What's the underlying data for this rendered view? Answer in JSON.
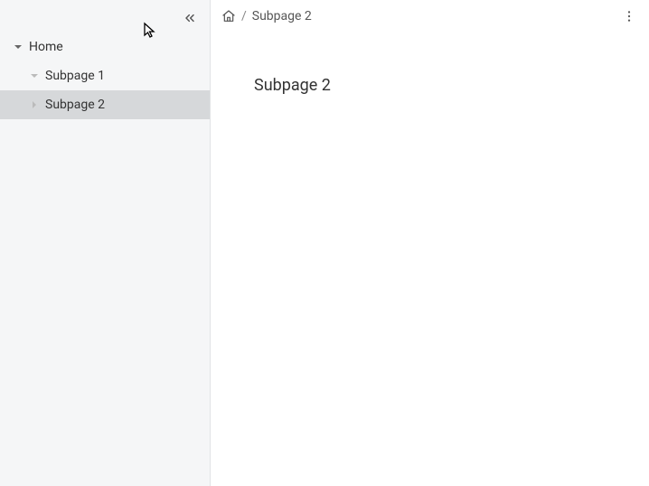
{
  "sidebar": {
    "items": [
      {
        "label": "Home",
        "level": 0,
        "expanded": true,
        "selected": false
      },
      {
        "label": "Subpage 1",
        "level": 1,
        "expanded": false,
        "selected": false,
        "dim": true
      },
      {
        "label": "Subpage 2",
        "level": 1,
        "expanded": false,
        "selected": true,
        "dim": true
      }
    ]
  },
  "breadcrumb": {
    "separator": "/",
    "current": "Subpage 2"
  },
  "page": {
    "title": "Subpage 2"
  }
}
